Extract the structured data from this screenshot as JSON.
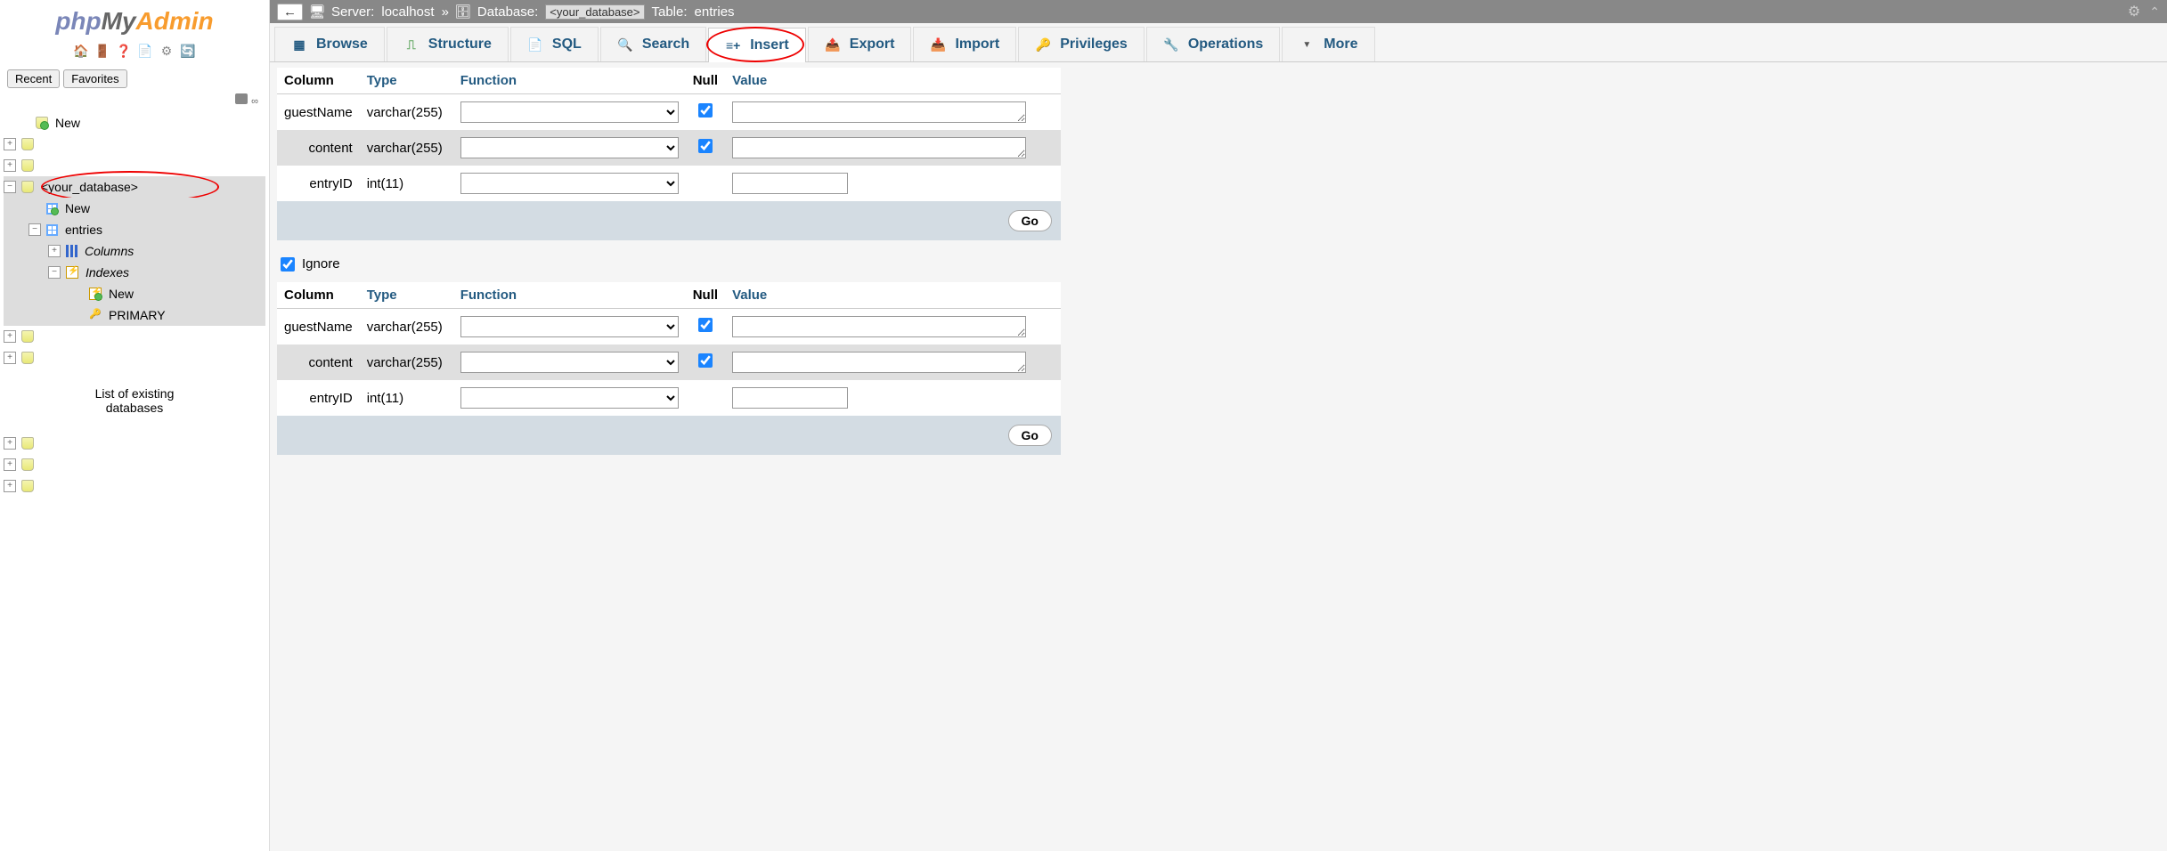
{
  "logo": {
    "php": "php",
    "my": "My",
    "admin": "Admin"
  },
  "sidebar": {
    "tabs": {
      "recent": "Recent",
      "favorites": "Favorites"
    },
    "tree": {
      "new_top": "New",
      "your_db": "<your_database>",
      "new_table": "New",
      "entries": "entries",
      "columns": "Columns",
      "indexes": "Indexes",
      "new_index": "New",
      "primary": "PRIMARY"
    },
    "annotation": "List of existing\ndatabases"
  },
  "breadcrumb": {
    "server_label": "Server:",
    "server_value": "localhost",
    "database_label": "Database:",
    "database_value": "<your_database>",
    "table_label": "Table:",
    "table_value": "entries"
  },
  "tabs": {
    "browse": "Browse",
    "structure": "Structure",
    "sql": "SQL",
    "search": "Search",
    "insert": "Insert",
    "export": "Export",
    "import": "Import",
    "privileges": "Privileges",
    "operations": "Operations",
    "more": "More"
  },
  "headers": {
    "column": "Column",
    "type": "Type",
    "function": "Function",
    "null": "Null",
    "value": "Value"
  },
  "rows": [
    {
      "name": "guestName",
      "type": "varchar(255)",
      "null": true,
      "textarea": true
    },
    {
      "name": "content",
      "type": "varchar(255)",
      "null": true,
      "textarea": true
    },
    {
      "name": "entryID",
      "type": "int(11)",
      "null": false,
      "textarea": false
    }
  ],
  "buttons": {
    "go": "Go"
  },
  "ignore": {
    "label": "Ignore",
    "checked": true
  }
}
